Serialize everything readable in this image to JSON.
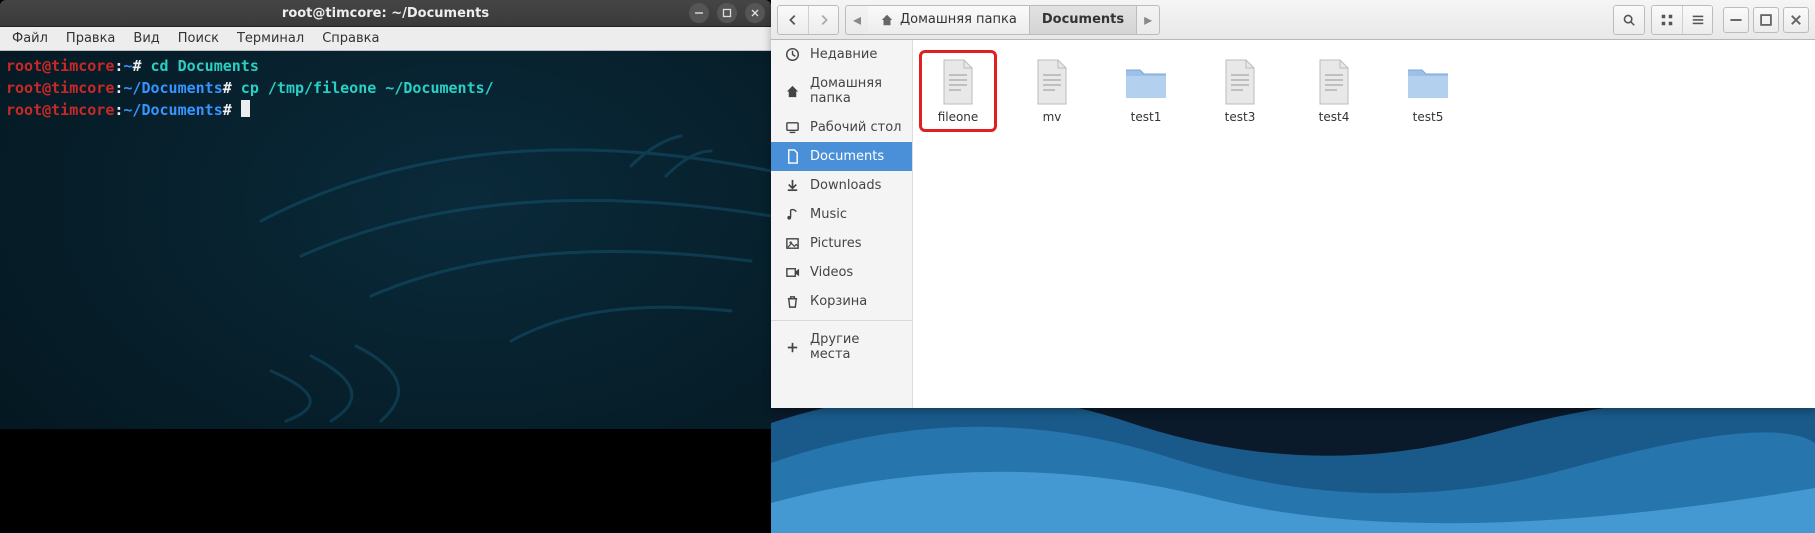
{
  "terminal": {
    "title": "root@timcore: ~/Documents",
    "menu": [
      "Файл",
      "Правка",
      "Вид",
      "Поиск",
      "Терминал",
      "Справка"
    ],
    "lines": [
      {
        "user": "root@timcore",
        "sep1": ":",
        "path": "~",
        "sep2": "#",
        "cmd": " cd Documents"
      },
      {
        "user": "root@timcore",
        "sep1": ":",
        "path": "~/Documents",
        "sep2": "#",
        "cmd": " cp /tmp/fileone ~/Documents/"
      },
      {
        "user": "root@timcore",
        "sep1": ":",
        "path": "~/Documents",
        "sep2": "#",
        "cmd": ""
      }
    ]
  },
  "files": {
    "breadcrumb_home": "Домашняя папка",
    "breadcrumb_current": "Documents",
    "sidebar": [
      {
        "icon": "clock",
        "label": "Недавние"
      },
      {
        "icon": "home",
        "label": "Домашняя папка"
      },
      {
        "icon": "desktop",
        "label": "Рабочий стол"
      },
      {
        "icon": "doc",
        "label": "Documents",
        "active": true
      },
      {
        "icon": "download",
        "label": "Downloads"
      },
      {
        "icon": "music",
        "label": "Music"
      },
      {
        "icon": "picture",
        "label": "Pictures"
      },
      {
        "icon": "video",
        "label": "Videos"
      },
      {
        "icon": "trash",
        "label": "Корзина"
      }
    ],
    "other_places": "Другие места",
    "items": [
      {
        "name": "fileone",
        "type": "file",
        "highlight": true
      },
      {
        "name": "mv",
        "type": "file"
      },
      {
        "name": "test1",
        "type": "folder"
      },
      {
        "name": "test3",
        "type": "file"
      },
      {
        "name": "test4",
        "type": "file"
      },
      {
        "name": "test5",
        "type": "folder"
      }
    ]
  }
}
